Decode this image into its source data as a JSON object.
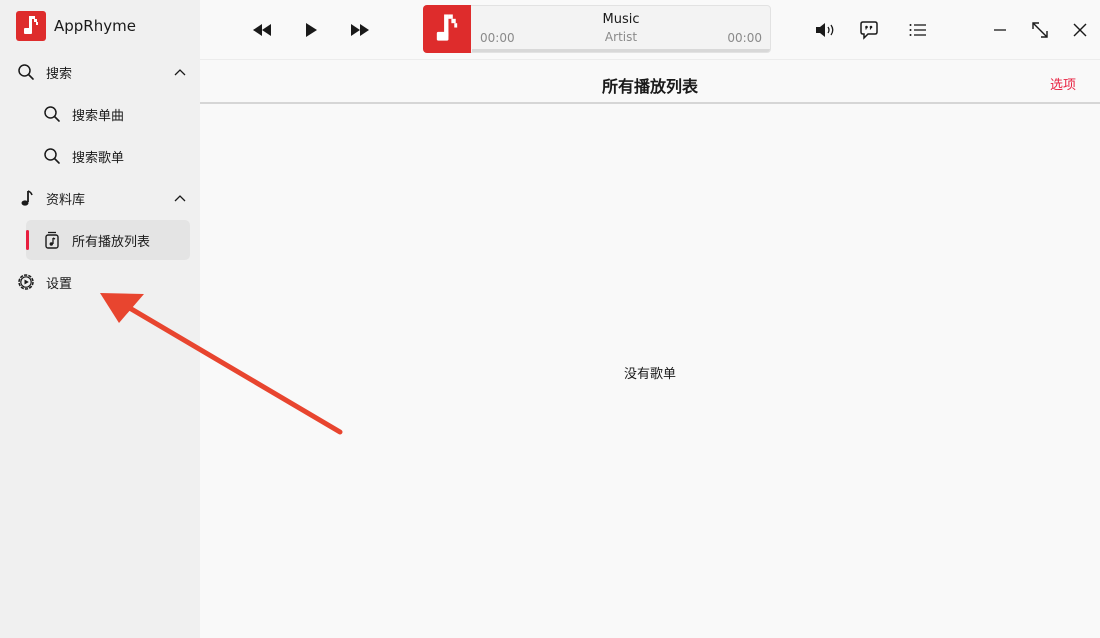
{
  "app": {
    "title": "AppRhyme"
  },
  "sidebar": {
    "search": {
      "label": "搜索",
      "children": [
        {
          "label": "搜索单曲"
        },
        {
          "label": "搜索歌单"
        }
      ]
    },
    "library": {
      "label": "资料库",
      "children": [
        {
          "label": "所有播放列表"
        }
      ]
    },
    "settings": {
      "label": "设置"
    }
  },
  "player": {
    "title": "Music",
    "artist": "Artist",
    "position": "00:00",
    "duration": "00:00",
    "progress": 0
  },
  "page": {
    "title": "所有播放列表",
    "options_label": "选项",
    "empty_text": "没有歌单"
  },
  "colors": {
    "accent": "#e81f3f",
    "logo": "#de2c2c",
    "annotation_arrow": "#e8452f"
  }
}
